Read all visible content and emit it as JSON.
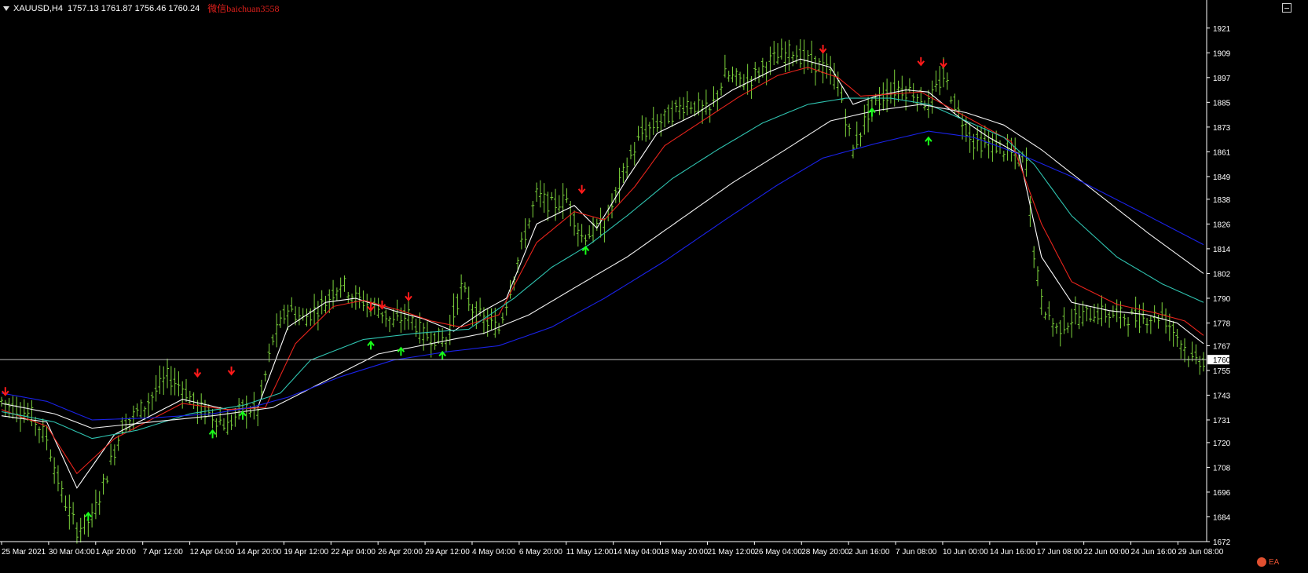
{
  "header": {
    "symbol": "XAUUSD,H4",
    "ohlc": "1757.13 1761.87 1756.46 1760.24",
    "watermark": "微信baichuan3558"
  },
  "logo_text": "EA",
  "colors": {
    "background": "#000000",
    "bars": "#7cd33c",
    "ema_fast": "#ffffff",
    "ema_red": "#e8241c",
    "ema_teal": "#2fc3b0",
    "ema_white_slow": "#f0f0f0",
    "ema_blue": "#1a22e8",
    "arrow_up": "#19ff19",
    "arrow_down": "#ff1a1a",
    "axis_text": "#ffffff",
    "price_line": "#c0c0c0"
  },
  "chart_data": {
    "type": "ohlc",
    "title": "",
    "symbol": "XAUUSD",
    "timeframe": "H4",
    "current_price": "1760",
    "ylim": [
      1672,
      1927
    ],
    "y_ticks": [
      "1921",
      "1909",
      "1897",
      "1885",
      "1873",
      "1861",
      "1849",
      "1838",
      "1826",
      "1814",
      "1802",
      "1790",
      "1778",
      "1767",
      "1755",
      "1743",
      "1731",
      "1720",
      "1708",
      "1696",
      "1684",
      "1672"
    ],
    "x_ticks": [
      "25 Mar 2021",
      "30 Mar 04:00",
      "1 Apr 20:00",
      "7 Apr 12:00",
      "12 Apr 04:00",
      "14 Apr 20:00",
      "19 Apr 12:00",
      "22 Apr 04:00",
      "26 Apr 20:00",
      "29 Apr 12:00",
      "4 May 04:00",
      "6 May 20:00",
      "11 May 12:00",
      "14 May 04:00",
      "18 May 20:00",
      "21 May 12:00",
      "26 May 04:00",
      "28 May 20:00",
      "2 Jun 16:00",
      "7 Jun 08:00",
      "10 Jun 00:00",
      "14 Jun 16:00",
      "17 Jun 08:00",
      "22 Jun 00:00",
      "24 Jun 16:00",
      "29 Jun 08:00"
    ],
    "price_path": [
      [
        0,
        1740
      ],
      [
        8,
        1733
      ],
      [
        12,
        1722
      ],
      [
        16,
        1695
      ],
      [
        20,
        1678
      ],
      [
        24,
        1683
      ],
      [
        28,
        1705
      ],
      [
        32,
        1728
      ],
      [
        38,
        1738
      ],
      [
        44,
        1752
      ],
      [
        48,
        1747
      ],
      [
        52,
        1737
      ],
      [
        56,
        1733
      ],
      [
        60,
        1728
      ],
      [
        64,
        1737
      ],
      [
        68,
        1735
      ],
      [
        72,
        1770
      ],
      [
        76,
        1785
      ],
      [
        80,
        1780
      ],
      [
        86,
        1788
      ],
      [
        90,
        1798
      ],
      [
        94,
        1790
      ],
      [
        100,
        1785
      ],
      [
        104,
        1778
      ],
      [
        108,
        1782
      ],
      [
        112,
        1772
      ],
      [
        118,
        1770
      ],
      [
        122,
        1795
      ],
      [
        126,
        1782
      ],
      [
        132,
        1775
      ],
      [
        138,
        1815
      ],
      [
        142,
        1840
      ],
      [
        146,
        1835
      ],
      [
        150,
        1838
      ],
      [
        154,
        1820
      ],
      [
        160,
        1825
      ],
      [
        166,
        1855
      ],
      [
        170,
        1870
      ],
      [
        176,
        1877
      ],
      [
        182,
        1885
      ],
      [
        188,
        1880
      ],
      [
        192,
        1898
      ],
      [
        198,
        1895
      ],
      [
        204,
        1905
      ],
      [
        210,
        1910
      ],
      [
        214,
        1905
      ],
      [
        218,
        1902
      ],
      [
        222,
        1895
      ],
      [
        224,
        1878
      ],
      [
        226,
        1862
      ],
      [
        230,
        1880
      ],
      [
        234,
        1888
      ],
      [
        238,
        1892
      ],
      [
        242,
        1890
      ],
      [
        246,
        1884
      ],
      [
        250,
        1898
      ],
      [
        254,
        1880
      ],
      [
        258,
        1866
      ],
      [
        264,
        1864
      ],
      [
        268,
        1860
      ],
      [
        272,
        1856
      ],
      [
        274,
        1812
      ],
      [
        276,
        1788
      ],
      [
        280,
        1775
      ],
      [
        284,
        1780
      ],
      [
        290,
        1783
      ],
      [
        296,
        1782
      ],
      [
        302,
        1780
      ],
      [
        308,
        1782
      ],
      [
        312,
        1772
      ],
      [
        316,
        1760
      ],
      [
        319,
        1760
      ]
    ],
    "series": [
      {
        "values": [
          [
            0,
            1733
          ],
          [
            12,
            1730
          ],
          [
            20,
            1698
          ],
          [
            30,
            1724
          ],
          [
            48,
            1741
          ],
          [
            60,
            1736
          ],
          [
            68,
            1737
          ],
          [
            76,
            1776
          ],
          [
            86,
            1788
          ],
          [
            94,
            1790
          ],
          [
            104,
            1784
          ],
          [
            112,
            1780
          ],
          [
            120,
            1774
          ],
          [
            128,
            1784
          ],
          [
            134,
            1790
          ],
          [
            142,
            1826
          ],
          [
            152,
            1835
          ],
          [
            158,
            1824
          ],
          [
            166,
            1848
          ],
          [
            174,
            1870
          ],
          [
            184,
            1879
          ],
          [
            194,
            1891
          ],
          [
            204,
            1900
          ],
          [
            212,
            1906
          ],
          [
            220,
            1902
          ],
          [
            226,
            1884
          ],
          [
            232,
            1888
          ],
          [
            240,
            1891
          ],
          [
            246,
            1890
          ],
          [
            254,
            1878
          ],
          [
            262,
            1868
          ],
          [
            270,
            1860
          ],
          [
            276,
            1810
          ],
          [
            284,
            1788
          ],
          [
            294,
            1784
          ],
          [
            304,
            1782
          ],
          [
            312,
            1778
          ],
          [
            319,
            1768
          ]
        ]
      },
      {
        "values": [
          [
            0,
            1736
          ],
          [
            12,
            1728
          ],
          [
            20,
            1705
          ],
          [
            30,
            1722
          ],
          [
            48,
            1739
          ],
          [
            60,
            1736
          ],
          [
            70,
            1737
          ],
          [
            78,
            1768
          ],
          [
            88,
            1786
          ],
          [
            96,
            1789
          ],
          [
            106,
            1784
          ],
          [
            114,
            1779
          ],
          [
            122,
            1776
          ],
          [
            132,
            1782
          ],
          [
            142,
            1817
          ],
          [
            152,
            1832
          ],
          [
            160,
            1828
          ],
          [
            168,
            1844
          ],
          [
            176,
            1864
          ],
          [
            186,
            1876
          ],
          [
            196,
            1888
          ],
          [
            206,
            1898
          ],
          [
            214,
            1902
          ],
          [
            222,
            1897
          ],
          [
            228,
            1888
          ],
          [
            236,
            1889
          ],
          [
            244,
            1890
          ],
          [
            252,
            1882
          ],
          [
            260,
            1874
          ],
          [
            268,
            1866
          ],
          [
            276,
            1826
          ],
          [
            284,
            1798
          ],
          [
            296,
            1787
          ],
          [
            306,
            1783
          ],
          [
            314,
            1779
          ],
          [
            319,
            1772
          ]
        ]
      },
      {
        "values": [
          [
            0,
            1735
          ],
          [
            14,
            1730
          ],
          [
            24,
            1722
          ],
          [
            36,
            1726
          ],
          [
            50,
            1734
          ],
          [
            64,
            1738
          ],
          [
            74,
            1744
          ],
          [
            82,
            1760
          ],
          [
            96,
            1770
          ],
          [
            110,
            1773
          ],
          [
            124,
            1775
          ],
          [
            136,
            1790
          ],
          [
            146,
            1805
          ],
          [
            156,
            1816
          ],
          [
            166,
            1830
          ],
          [
            178,
            1848
          ],
          [
            190,
            1862
          ],
          [
            202,
            1875
          ],
          [
            214,
            1884
          ],
          [
            224,
            1887
          ],
          [
            236,
            1887
          ],
          [
            246,
            1884
          ],
          [
            256,
            1876
          ],
          [
            266,
            1868
          ],
          [
            274,
            1855
          ],
          [
            284,
            1830
          ],
          [
            296,
            1810
          ],
          [
            308,
            1797
          ],
          [
            319,
            1788
          ]
        ]
      },
      {
        "values": [
          [
            0,
            1739
          ],
          [
            14,
            1734
          ],
          [
            24,
            1727
          ],
          [
            40,
            1730
          ],
          [
            56,
            1733
          ],
          [
            72,
            1737
          ],
          [
            86,
            1750
          ],
          [
            100,
            1763
          ],
          [
            114,
            1768
          ],
          [
            128,
            1773
          ],
          [
            140,
            1782
          ],
          [
            152,
            1795
          ],
          [
            166,
            1810
          ],
          [
            180,
            1828
          ],
          [
            194,
            1846
          ],
          [
            208,
            1862
          ],
          [
            220,
            1876
          ],
          [
            232,
            1881
          ],
          [
            244,
            1884
          ],
          [
            256,
            1880
          ],
          [
            266,
            1874
          ],
          [
            276,
            1862
          ],
          [
            290,
            1842
          ],
          [
            304,
            1822
          ],
          [
            319,
            1802
          ]
        ]
      },
      {
        "values": [
          [
            0,
            1744
          ],
          [
            12,
            1740
          ],
          [
            24,
            1731
          ],
          [
            40,
            1732
          ],
          [
            56,
            1734
          ],
          [
            66,
            1737
          ],
          [
            76,
            1742
          ],
          [
            90,
            1752
          ],
          [
            104,
            1760
          ],
          [
            118,
            1764
          ],
          [
            132,
            1767
          ],
          [
            146,
            1776
          ],
          [
            160,
            1790
          ],
          [
            176,
            1808
          ],
          [
            192,
            1828
          ],
          [
            206,
            1845
          ],
          [
            218,
            1858
          ],
          [
            232,
            1865
          ],
          [
            246,
            1871
          ],
          [
            258,
            1868
          ],
          [
            270,
            1860
          ],
          [
            284,
            1849
          ],
          [
            300,
            1834
          ],
          [
            319,
            1816
          ]
        ]
      }
    ],
    "arrows_up": [
      [
        23,
        1684
      ],
      [
        56,
        1724
      ],
      [
        64,
        1733
      ],
      [
        98,
        1767
      ],
      [
        106,
        1764
      ],
      [
        117,
        1762
      ],
      [
        155,
        1813
      ],
      [
        231,
        1880
      ],
      [
        246,
        1866
      ]
    ],
    "arrows_down": [
      [
        1,
        1745
      ],
      [
        52,
        1754
      ],
      [
        61,
        1755
      ],
      [
        98,
        1786
      ],
      [
        101,
        1787
      ],
      [
        108,
        1791
      ],
      [
        154,
        1843
      ],
      [
        218,
        1911
      ],
      [
        244,
        1905
      ],
      [
        250,
        1904
      ]
    ]
  }
}
